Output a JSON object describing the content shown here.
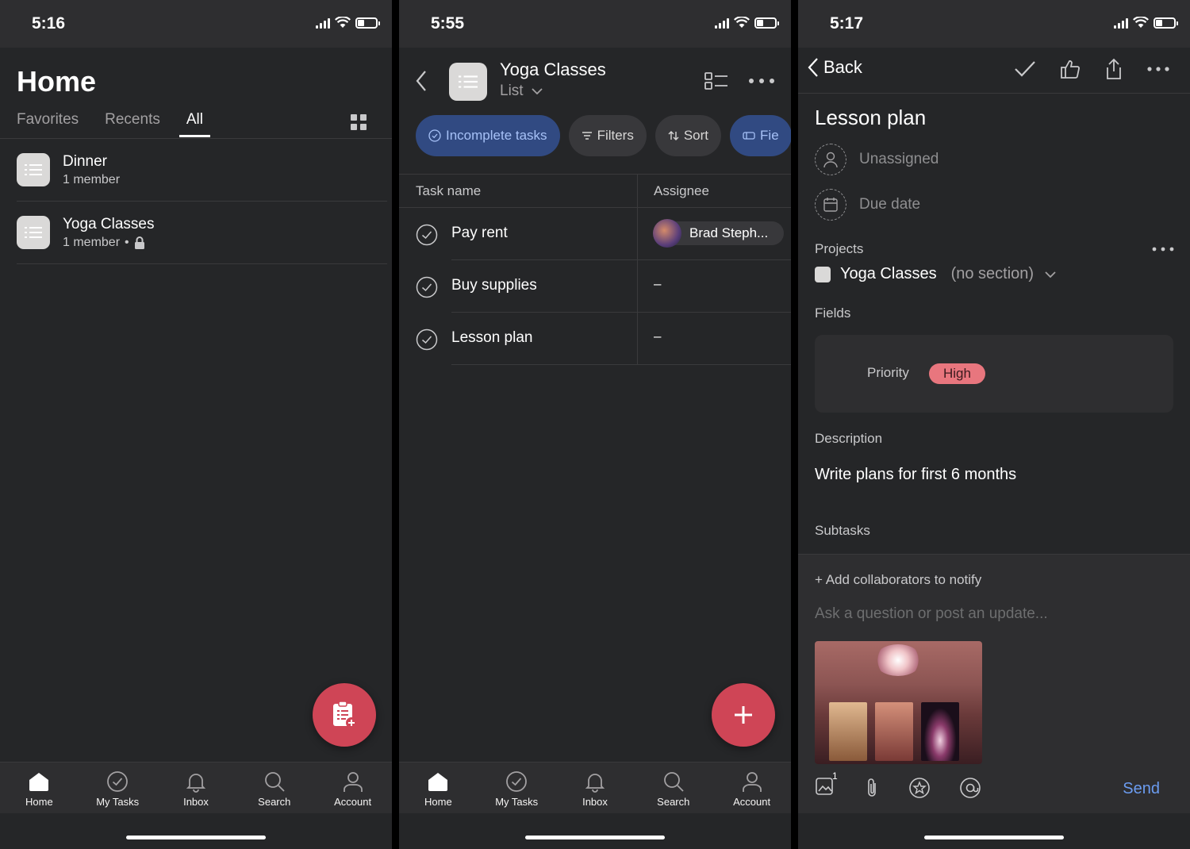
{
  "screen1": {
    "status_time": "5:16",
    "title": "Home",
    "tabs": [
      {
        "label": "Favorites"
      },
      {
        "label": "Recents"
      },
      {
        "label": "All"
      }
    ],
    "projects": [
      {
        "name": "Dinner",
        "subtitle": "1 member",
        "locked": false
      },
      {
        "name": "Yoga Classes",
        "subtitle": "1 member",
        "locked": true
      }
    ],
    "fab_icon": "new-task-icon"
  },
  "screen2": {
    "status_time": "5:55",
    "project_title": "Yoga Classes",
    "view_label": "List",
    "chips": [
      {
        "label": "Incomplete tasks",
        "icon": "check-circle-icon"
      },
      {
        "label": "Filters",
        "icon": "filter-icon"
      },
      {
        "label": "Sort",
        "icon": "sort-icon"
      },
      {
        "label": "Fie",
        "icon": "fields-icon"
      }
    ],
    "columns": {
      "task": "Task name",
      "assignee": "Assignee"
    },
    "tasks": [
      {
        "name": "Pay rent",
        "assignee": "Brad Steph..."
      },
      {
        "name": "Buy supplies",
        "assignee": "–"
      },
      {
        "name": "Lesson plan",
        "assignee": "–"
      }
    ],
    "fab_icon": "plus-icon"
  },
  "screen3": {
    "status_time": "5:17",
    "back_label": "Back",
    "task_title": "Lesson plan",
    "assignee_placeholder": "Unassigned",
    "due_placeholder": "Due date",
    "projects_label": "Projects",
    "project_name": "Yoga Classes",
    "section_name": "(no section)",
    "fields_label": "Fields",
    "priority_label": "Priority",
    "priority_value": "High",
    "description_label": "Description",
    "description": "Write plans for first 6 months",
    "subtasks_label": "Subtasks",
    "add_collaborators": "+ Add collaborators to notify",
    "comment_placeholder": "Ask a question or post an update...",
    "attachment_count": "1",
    "send_label": "Send"
  },
  "nav": [
    {
      "label": "Home",
      "icon": "home-icon"
    },
    {
      "label": "My Tasks",
      "icon": "check-circle-icon"
    },
    {
      "label": "Inbox",
      "icon": "bell-icon"
    },
    {
      "label": "Search",
      "icon": "search-icon"
    },
    {
      "label": "Account",
      "icon": "person-icon"
    }
  ],
  "colors": {
    "background": "#252628",
    "accent": "#cf4556",
    "chip_primary": "#314a82",
    "priority_high": "#e8767e",
    "send": "#6b9cf0"
  }
}
